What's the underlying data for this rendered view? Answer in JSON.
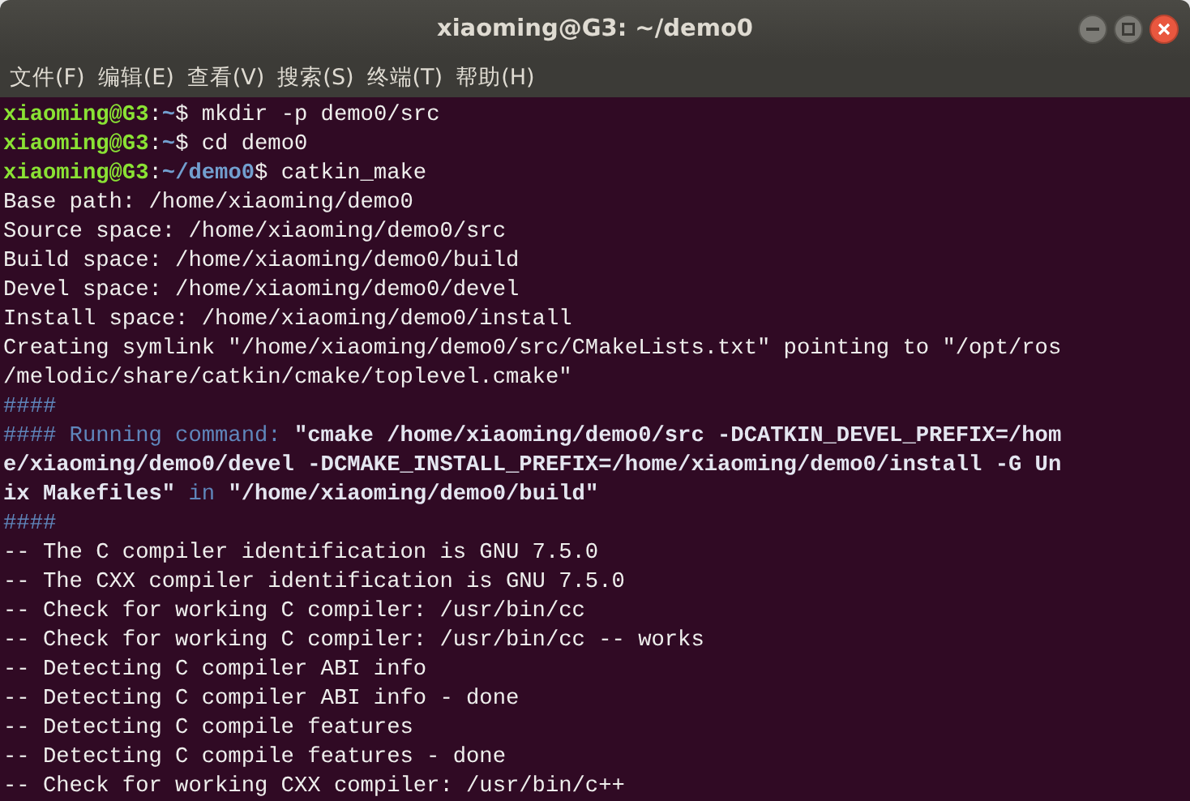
{
  "window": {
    "title": "xiaoming@G3: ~/demo0"
  },
  "menu": [
    "文件(F)",
    "编辑(E)",
    "查看(V)",
    "搜索(S)",
    "终端(T)",
    "帮助(H)"
  ],
  "terminal": {
    "lines": [
      {
        "segments": [
          {
            "kind": "user",
            "text": "xiaoming@G3"
          },
          {
            "kind": "plain",
            "text": ":"
          },
          {
            "kind": "path",
            "text": "~"
          },
          {
            "kind": "plain",
            "text": "$ mkdir -p demo0/src"
          }
        ]
      },
      {
        "segments": [
          {
            "kind": "user",
            "text": "xiaoming@G3"
          },
          {
            "kind": "plain",
            "text": ":"
          },
          {
            "kind": "path",
            "text": "~"
          },
          {
            "kind": "plain",
            "text": "$ cd demo0"
          }
        ]
      },
      {
        "segments": [
          {
            "kind": "user",
            "text": "xiaoming@G3"
          },
          {
            "kind": "plain",
            "text": ":"
          },
          {
            "kind": "path",
            "text": "~/demo0"
          },
          {
            "kind": "plain",
            "text": "$ catkin_make"
          }
        ]
      },
      {
        "segments": [
          {
            "kind": "plain",
            "text": "Base path: /home/xiaoming/demo0"
          }
        ]
      },
      {
        "segments": [
          {
            "kind": "plain",
            "text": "Source space: /home/xiaoming/demo0/src"
          }
        ]
      },
      {
        "segments": [
          {
            "kind": "plain",
            "text": "Build space: /home/xiaoming/demo0/build"
          }
        ]
      },
      {
        "segments": [
          {
            "kind": "plain",
            "text": "Devel space: /home/xiaoming/demo0/devel"
          }
        ]
      },
      {
        "segments": [
          {
            "kind": "plain",
            "text": "Install space: /home/xiaoming/demo0/install"
          }
        ]
      },
      {
        "segments": [
          {
            "kind": "plain",
            "text": "Creating symlink \"/home/xiaoming/demo0/src/CMakeLists.txt\" pointing to \"/opt/ros"
          }
        ]
      },
      {
        "segments": [
          {
            "kind": "plain",
            "text": "/melodic/share/catkin/cmake/toplevel.cmake\""
          }
        ]
      },
      {
        "segments": [
          {
            "kind": "comment",
            "text": "####"
          }
        ]
      },
      {
        "segments": [
          {
            "kind": "comment",
            "text": "#### Running command: "
          },
          {
            "kind": "bold",
            "text": "\"cmake /home/xiaoming/demo0/src -DCATKIN_DEVEL_PREFIX=/hom"
          }
        ]
      },
      {
        "segments": [
          {
            "kind": "bold",
            "text": "e/xiaoming/demo0/devel -DCMAKE_INSTALL_PREFIX=/home/xiaoming/demo0/install -G Un"
          }
        ]
      },
      {
        "segments": [
          {
            "kind": "bold",
            "text": "ix Makefiles\""
          },
          {
            "kind": "comment",
            "text": " in "
          },
          {
            "kind": "bold",
            "text": "\"/home/xiaoming/demo0/build\""
          }
        ]
      },
      {
        "segments": [
          {
            "kind": "comment",
            "text": "####"
          }
        ]
      },
      {
        "segments": [
          {
            "kind": "plain",
            "text": "-- The C compiler identification is GNU 7.5.0"
          }
        ]
      },
      {
        "segments": [
          {
            "kind": "plain",
            "text": "-- The CXX compiler identification is GNU 7.5.0"
          }
        ]
      },
      {
        "segments": [
          {
            "kind": "plain",
            "text": "-- Check for working C compiler: /usr/bin/cc"
          }
        ]
      },
      {
        "segments": [
          {
            "kind": "plain",
            "text": "-- Check for working C compiler: /usr/bin/cc -- works"
          }
        ]
      },
      {
        "segments": [
          {
            "kind": "plain",
            "text": "-- Detecting C compiler ABI info"
          }
        ]
      },
      {
        "segments": [
          {
            "kind": "plain",
            "text": "-- Detecting C compiler ABI info - done"
          }
        ]
      },
      {
        "segments": [
          {
            "kind": "plain",
            "text": "-- Detecting C compile features"
          }
        ]
      },
      {
        "segments": [
          {
            "kind": "plain",
            "text": "-- Detecting C compile features - done"
          }
        ]
      },
      {
        "segments": [
          {
            "kind": "plain",
            "text": "-- Check for working CXX compiler: /usr/bin/c++"
          }
        ]
      }
    ]
  }
}
